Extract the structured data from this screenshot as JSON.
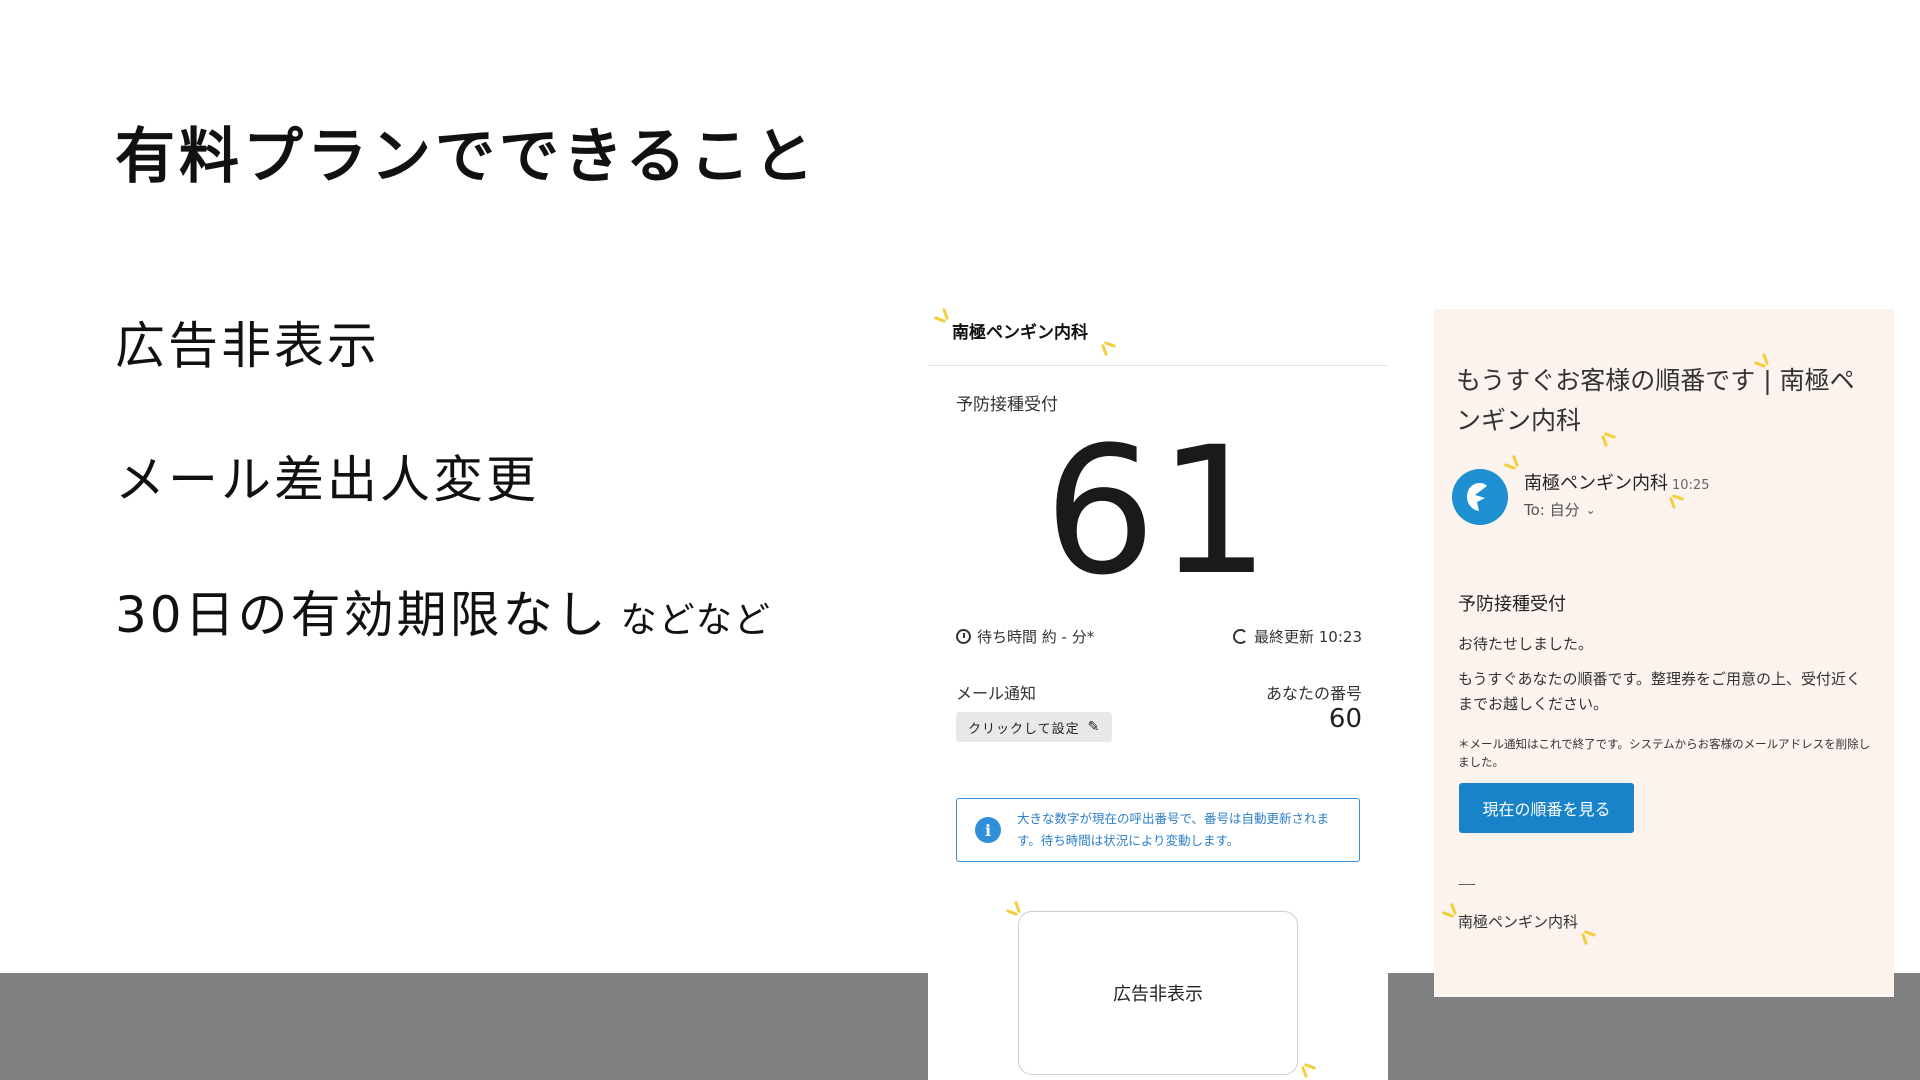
{
  "slide": {
    "title": "有料プランでできること",
    "features": [
      "広告非表示",
      "メール差出人変更",
      "30日の有効期限なし"
    ],
    "feature_suffix": "などなど"
  },
  "reception_screen": {
    "clinic_name": "南極ペンギン内科",
    "section_label": "予防接種受付",
    "current_number": "61",
    "wait_time": "待ち時間 約 - 分*",
    "last_updated": "最終更新 10:23",
    "mail_notification_label": "メール通知",
    "set_button_label": "クリックして設定",
    "your_number_label": "あなたの番号",
    "your_number": "60",
    "info_text": "大きな数字が現在の呼出番号で、番号は自動更新されます。待ち時間は状況により変動します。",
    "ad_box_label": "広告非表示"
  },
  "email": {
    "subject": "もうすぐお客様の順番です | 南極ペンギン内科",
    "sender": "南極ペンギン内科",
    "time": "10:25",
    "to": "To: 自分",
    "heading": "予防接種受付",
    "greeting": "お待たせしました。",
    "body": "もうすぐあなたの順番です。整理券をご用意の上、受付近くまでお越しください。",
    "note": "＊メール通知はこれで終了です。システムからお客様のメールアドレスを削除しました。",
    "button_label": "現在の順番を見る",
    "divider": "-----",
    "footer": "南極ペンギン内科"
  },
  "colors": {
    "accent_blue": "#1883c9",
    "email_background": "#fcf3ee",
    "bottom_band": "#808080",
    "sparkle": "#f2cf3c"
  }
}
